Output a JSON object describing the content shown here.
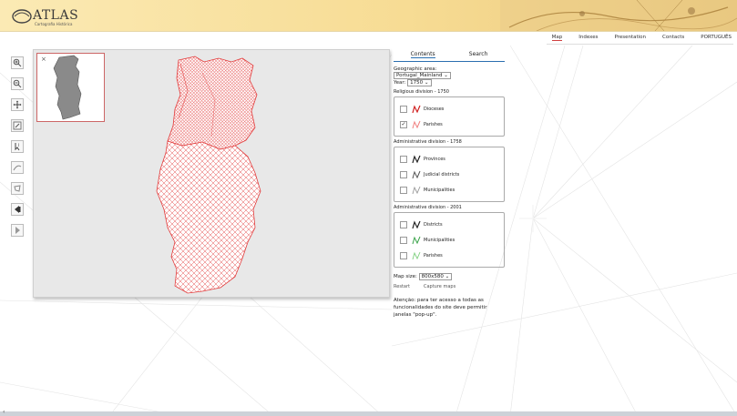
{
  "header": {
    "logo_text": "ATLAS",
    "logo_sub": "Cartografia Histórica",
    "nav": [
      {
        "label": "Map",
        "active": true
      },
      {
        "label": "Indexes",
        "active": false
      },
      {
        "label": "Presentation",
        "active": false
      },
      {
        "label": "Contacts",
        "active": false
      },
      {
        "label": "PORTUGUÊS",
        "active": false
      }
    ]
  },
  "toolbar": {
    "tools": [
      "zoom-in-icon",
      "zoom-out-icon",
      "pan-icon",
      "zoom-box-icon",
      "identify-icon",
      "measure-line-icon",
      "measure-area-icon",
      "back-icon",
      "forward-icon"
    ]
  },
  "map": {
    "close_label": "×",
    "accent_color": "#e23c3c"
  },
  "sidebar": {
    "tabs": [
      {
        "label": "Contents",
        "active": true
      },
      {
        "label": "Search",
        "active": false
      }
    ],
    "geo_label": "Geographic area:",
    "geo_value": "Portugal_Mainland",
    "year_label": "Year:",
    "year_value": "1750",
    "sections": [
      {
        "title": "Religious division - 1750",
        "items": [
          {
            "label": "Dioceses",
            "checked": false,
            "color": "#d02020"
          },
          {
            "label": "Parishes",
            "checked": true,
            "color": "#f08080"
          }
        ]
      },
      {
        "title": "Administrative division - 1758",
        "items": [
          {
            "label": "Provinces",
            "checked": false,
            "color": "#222222"
          },
          {
            "label": "Judicial districts",
            "checked": false,
            "color": "#555555"
          },
          {
            "label": "Municipalities",
            "checked": false,
            "color": "#999999"
          }
        ]
      },
      {
        "title": "Administrative division - 2001",
        "items": [
          {
            "label": "Districts",
            "checked": false,
            "color": "#222222"
          },
          {
            "label": "Municipalities",
            "checked": false,
            "color": "#3aa34a"
          },
          {
            "label": "Parishes",
            "checked": false,
            "color": "#7fd07f"
          }
        ]
      }
    ],
    "map_size_label": "Map size:",
    "map_size_value": "800x580",
    "restart_label": "Restart",
    "capture_label": "Capture maps",
    "notice": "Atenção: para ter acesso a todas as funcionalidades do site deve permitir janelas \"pop-up\"."
  }
}
